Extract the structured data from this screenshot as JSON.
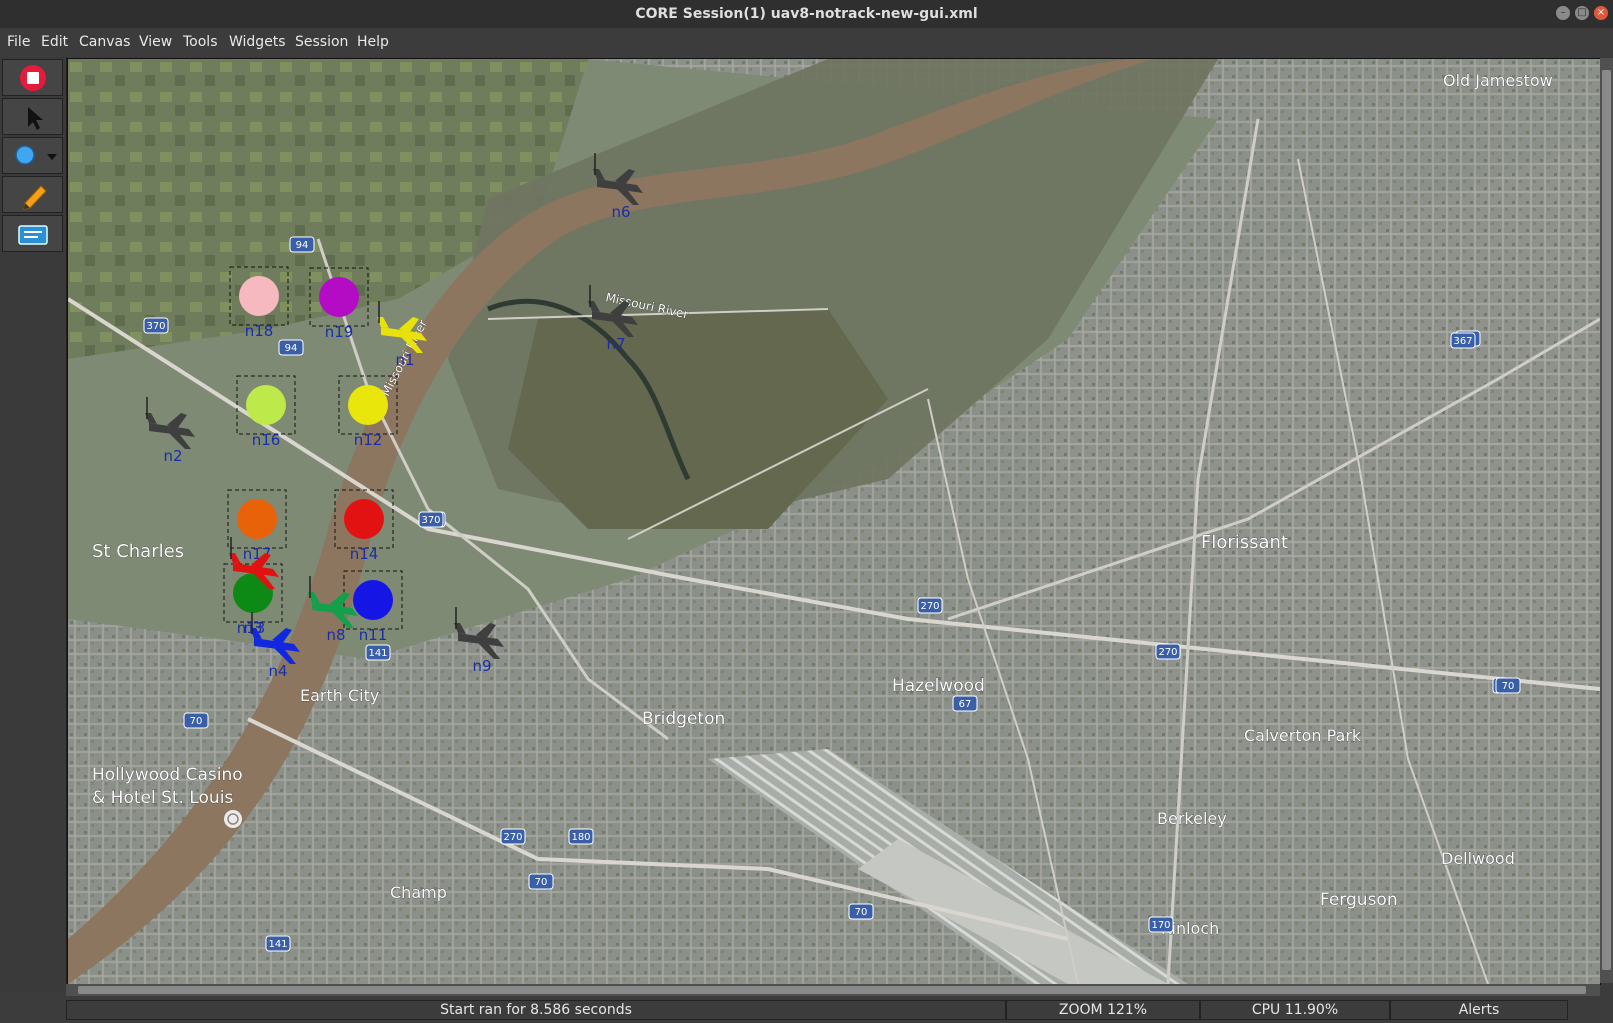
{
  "window": {
    "title": "CORE Session(1) uav8-notrack-new-gui.xml"
  },
  "menu": [
    "File",
    "Edit",
    "Canvas",
    "View",
    "Tools",
    "Widgets",
    "Session",
    "Help"
  ],
  "toolbar": [
    "stop-icon",
    "select-icon",
    "link-layer-icon",
    "marker-icon",
    "widget-icon"
  ],
  "map": {
    "places": [
      "Old Jamestow",
      "St Charles",
      "Florissant",
      "Hazelwood",
      "Bridgeton",
      "Earth City",
      "Calverton Park",
      "Berkeley",
      "Hollywood Casino",
      "& Hotel St. Louis",
      "Dellwood",
      "Ferguson",
      "Champ",
      "Kinloch",
      "Missouri River",
      "Missouri River"
    ],
    "shields": [
      "94",
      "94",
      "370",
      "370",
      "370",
      "270",
      "270",
      "270",
      "270",
      "67",
      "367",
      "141",
      "141",
      "70",
      "70",
      "70",
      "70",
      "180",
      "170",
      "67"
    ]
  },
  "nodes": {
    "circles": [
      {
        "label": "n18",
        "color": "#f6b9bf"
      },
      {
        "label": "n19",
        "color": "#b40bc4"
      },
      {
        "label": "n16",
        "color": "#bde94a"
      },
      {
        "label": "n12",
        "color": "#e8e60a"
      },
      {
        "label": "n17",
        "color": "#e8620a"
      },
      {
        "label": "n14",
        "color": "#e31212"
      },
      {
        "label": "n3",
        "color": "#0d8a16"
      },
      {
        "label": "n11",
        "color": "#1515e6"
      },
      {
        "label": "n13",
        "color": "#e31212"
      }
    ],
    "uavs": [
      {
        "label": "n6",
        "color": "#3f3f3f"
      },
      {
        "label": "n7",
        "color": "#3f3f3f"
      },
      {
        "label": "n1",
        "color": "#e8e20a"
      },
      {
        "label": "n2",
        "color": "#3f3f3f"
      },
      {
        "label": "n8",
        "color": "#12a04a"
      },
      {
        "label": "n4",
        "color": "#1228e0"
      },
      {
        "label": "n9",
        "color": "#3f3f3f"
      },
      {
        "label": "",
        "color": "#e01212"
      }
    ]
  },
  "status": {
    "message": "Start ran for 8.586 seconds",
    "zoom": "ZOOM 121%",
    "cpu": "CPU 11.90%",
    "alerts": "Alerts"
  }
}
